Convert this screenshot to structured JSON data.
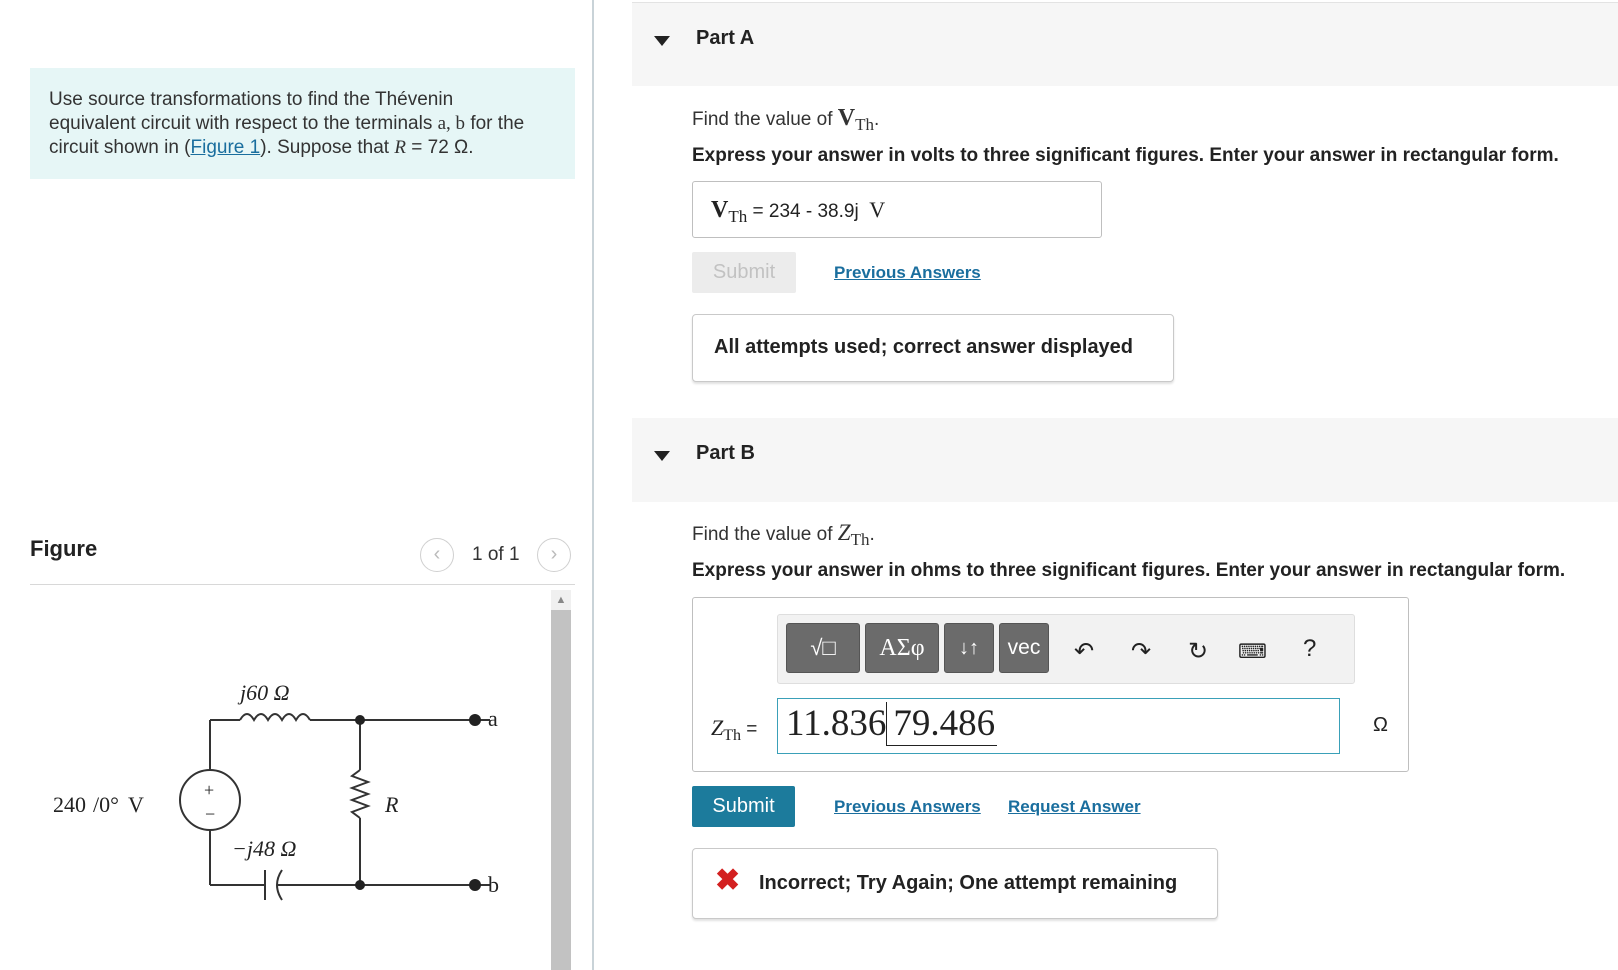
{
  "problem": {
    "line1": "Use source transformations to find the Thévenin",
    "line2_pre": "equivalent circuit with respect to the terminals ",
    "terminals": "a, b",
    "line2_post": " for the",
    "line3_pre": "circuit shown in (",
    "figure_link": "Figure 1",
    "line3_mid": "). Suppose that ",
    "r_symbol": "R",
    "r_value": " = 72 Ω."
  },
  "figure": {
    "title": "Figure",
    "prev_icon": "chevron-left-icon",
    "next_icon": "chevron-right-icon",
    "counter": "1 of 1",
    "circuit": {
      "inductor_label": "j60 Ω",
      "source_label": "240",
      "source_angle": "/0°",
      "source_unit": " V",
      "capacitor_label": "−j48 Ω",
      "resistor_label": "R",
      "terminal_a": "a",
      "terminal_b": "b",
      "plus": "+",
      "minus": "−"
    }
  },
  "partA": {
    "title": "Part A",
    "find_pre": "Find the value of ",
    "find_var": "V",
    "find_sub": "Th",
    "find_post": ".",
    "express": "Express your answer in volts to three significant figures. Enter your answer in rectangular form.",
    "answer_var": "V",
    "answer_sub": "Th",
    "answer_eq": " = ",
    "answer_value": "234 - 38.9j",
    "answer_unit": "V",
    "submit_label": "Submit",
    "previous_answers": "Previous Answers",
    "feedback": "All attempts used; correct answer displayed"
  },
  "partB": {
    "title": "Part B",
    "find_pre": "Find the value of ",
    "find_var": "Z",
    "find_sub": "Th",
    "find_post": ".",
    "express": "Express your answer in ohms to three significant figures. Enter your answer in rectangular form.",
    "toolbar": {
      "templates_label": "√□",
      "greek_label": "ΑΣφ",
      "arrows_label": "↓↑",
      "vec_label": "vec",
      "undo_icon": "undo-icon",
      "redo_icon": "redo-icon",
      "reset_icon": "reset-icon",
      "keyboard_icon": "keyboard-icon",
      "help_label": "?"
    },
    "input_var": "Z",
    "input_sub": "Th",
    "input_eq": " = ",
    "input_magnitude": "11.836",
    "input_angle": "79.486",
    "input_unit": "Ω",
    "submit_label": "Submit",
    "previous_answers": "Previous Answers",
    "request_answer": "Request Answer",
    "feedback": "Incorrect; Try Again; One attempt remaining"
  },
  "colors": {
    "problem_bg": "#e6f6f6",
    "link": "#1a6e9e",
    "submit_active": "#1c7b9c",
    "error": "#d32020"
  }
}
